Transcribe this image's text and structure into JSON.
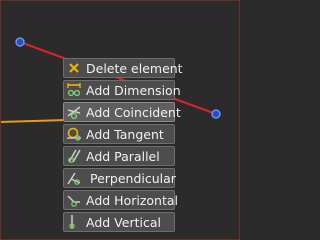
{
  "context_menu": {
    "items": [
      {
        "label": "Delete element",
        "icon": "delete-cross-icon"
      },
      {
        "label": "Add Dimension",
        "icon": "dimension-icon"
      },
      {
        "label": "Add Coincident",
        "icon": "coincident-icon"
      },
      {
        "label": "Add Tangent",
        "icon": "tangent-icon"
      },
      {
        "label": "Add Parallel",
        "icon": "parallel-icon"
      },
      {
        "label": "Perpendicular",
        "icon": "perpendicular-icon"
      },
      {
        "label": "Add Horizontal",
        "icon": "horizontal-icon"
      },
      {
        "label": "Add Vertical",
        "icon": "vertical-icon"
      }
    ]
  },
  "colors": {
    "background": "#2b2b2b",
    "selected_line": "#d9232b",
    "point_fill": "#2a4dbf",
    "point_stroke": "#6fa0ff",
    "orange_line": "#e89a1c",
    "frame": "#6b2f2a",
    "icon_orange": "#f0b400",
    "icon_green": "#7fd36a"
  }
}
